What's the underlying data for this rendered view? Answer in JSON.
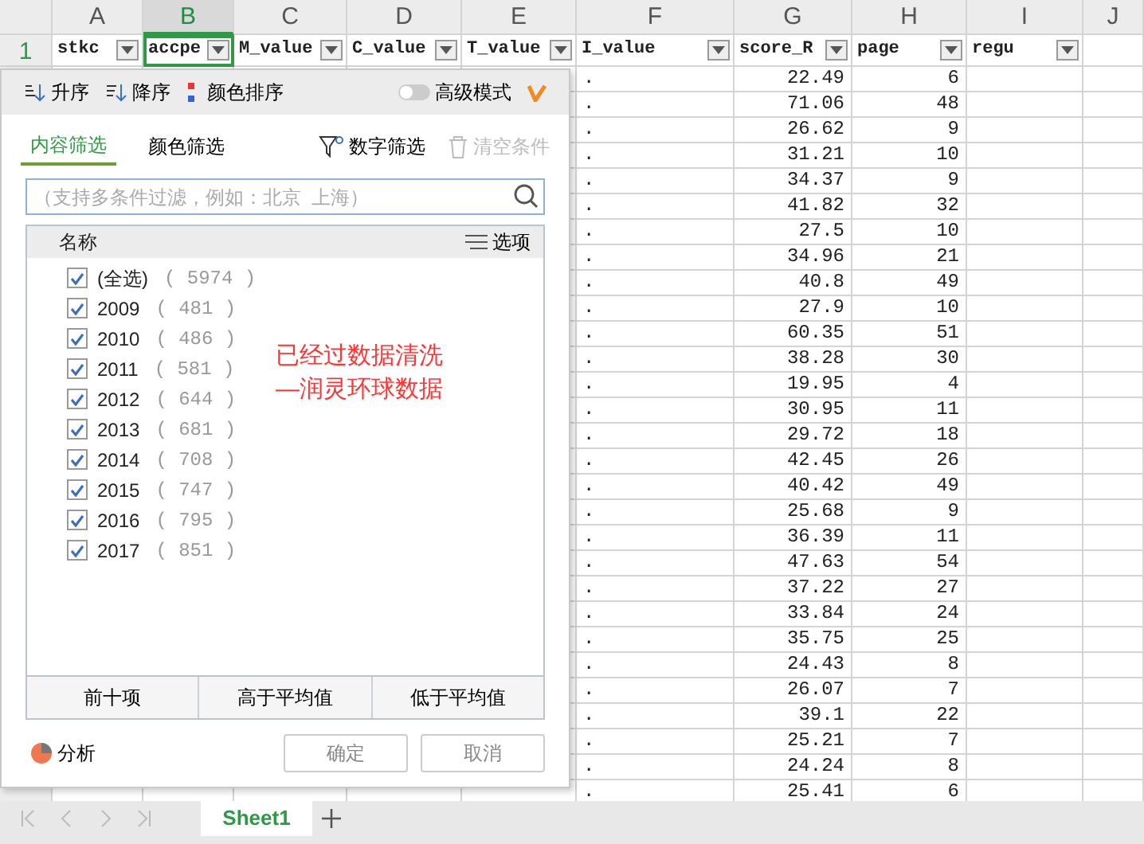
{
  "column_headers": [
    {
      "label": "A",
      "selected": false
    },
    {
      "label": "B",
      "selected": true
    },
    {
      "label": "C",
      "selected": false
    },
    {
      "label": "D",
      "selected": false
    },
    {
      "label": "E",
      "selected": false
    },
    {
      "label": "F",
      "selected": false
    },
    {
      "label": "G",
      "selected": false
    },
    {
      "label": "H",
      "selected": false
    },
    {
      "label": "I",
      "selected": false
    },
    {
      "label": "J",
      "selected": false
    }
  ],
  "header_row": {
    "row_number": "1",
    "cells": [
      {
        "text": "stkc",
        "selected": false
      },
      {
        "text": "accpe",
        "selected": true
      },
      {
        "text": "M_value",
        "selected": false
      },
      {
        "text": "C_value",
        "selected": false
      },
      {
        "text": "T_value",
        "selected": false
      },
      {
        "text": "I_value",
        "selected": false
      },
      {
        "text": "score_R",
        "selected": false
      },
      {
        "text": "page",
        "selected": false
      },
      {
        "text": "regu",
        "selected": false
      }
    ]
  },
  "rows": [
    {
      "i_value": ".",
      "score_r": "22.49",
      "page": "6"
    },
    {
      "i_value": ".",
      "score_r": "71.06",
      "page": "48"
    },
    {
      "i_value": ".",
      "score_r": "26.62",
      "page": "9"
    },
    {
      "i_value": ".",
      "score_r": "31.21",
      "page": "10"
    },
    {
      "i_value": ".",
      "score_r": "34.37",
      "page": "9"
    },
    {
      "i_value": ".",
      "score_r": "41.82",
      "page": "32"
    },
    {
      "i_value": ".",
      "score_r": "27.5",
      "page": "10"
    },
    {
      "i_value": ".",
      "score_r": "34.96",
      "page": "21"
    },
    {
      "i_value": ".",
      "score_r": "40.8",
      "page": "49"
    },
    {
      "i_value": ".",
      "score_r": "27.9",
      "page": "10"
    },
    {
      "i_value": ".",
      "score_r": "60.35",
      "page": "51"
    },
    {
      "i_value": ".",
      "score_r": "38.28",
      "page": "30"
    },
    {
      "i_value": ".",
      "score_r": "19.95",
      "page": "4"
    },
    {
      "i_value": ".",
      "score_r": "30.95",
      "page": "11"
    },
    {
      "i_value": ".",
      "score_r": "29.72",
      "page": "18"
    },
    {
      "i_value": ".",
      "score_r": "42.45",
      "page": "26"
    },
    {
      "i_value": ".",
      "score_r": "40.42",
      "page": "49"
    },
    {
      "i_value": ".",
      "score_r": "25.68",
      "page": "9"
    },
    {
      "i_value": ".",
      "score_r": "36.39",
      "page": "11"
    },
    {
      "i_value": ".",
      "score_r": "47.63",
      "page": "54"
    },
    {
      "i_value": ".",
      "score_r": "37.22",
      "page": "27"
    },
    {
      "i_value": ".",
      "score_r": "33.84",
      "page": "24"
    },
    {
      "i_value": ".",
      "score_r": "35.75",
      "page": "25"
    },
    {
      "i_value": ".",
      "score_r": "24.43",
      "page": "8"
    },
    {
      "i_value": ".",
      "score_r": "26.07",
      "page": "7"
    },
    {
      "i_value": ".",
      "score_r": "39.1",
      "page": "22"
    },
    {
      "i_value": ".",
      "score_r": "25.21",
      "page": "7"
    },
    {
      "i_value": ".",
      "score_r": "24.24",
      "page": "8"
    },
    {
      "i_value": ".",
      "score_r": "25.41",
      "page": "6"
    }
  ],
  "filter_panel": {
    "sort_buttons": [
      "升序",
      "降序",
      "颜色排序"
    ],
    "advanced_mode": {
      "label": "高级模式",
      "on": false
    },
    "tabs": [
      {
        "label": "内容筛选",
        "selected": true
      },
      {
        "label": "颜色筛选",
        "selected": false
      }
    ],
    "actions": [
      {
        "label": "数字筛选",
        "disabled": false
      },
      {
        "label": "清空条件",
        "disabled": true
      }
    ],
    "search": {
      "placeholder": "（支持多条件过滤，例如：北京  上海）"
    },
    "list_header": {
      "name": "名称",
      "options": "选项"
    },
    "items": [
      {
        "label": "(全选)",
        "count": "( 5974 )",
        "checked": true
      },
      {
        "label": "2009",
        "count": "( 481 )",
        "checked": true
      },
      {
        "label": "2010",
        "count": "( 486 )",
        "checked": true
      },
      {
        "label": "2011",
        "count": "( 581 )",
        "checked": true
      },
      {
        "label": "2012",
        "count": "( 644 )",
        "checked": true
      },
      {
        "label": "2013",
        "count": "( 681 )",
        "checked": true
      },
      {
        "label": "2014",
        "count": "( 708 )",
        "checked": true
      },
      {
        "label": "2015",
        "count": "( 747 )",
        "checked": true
      },
      {
        "label": "2016",
        "count": "( 795 )",
        "checked": true
      },
      {
        "label": "2017",
        "count": "( 851 )",
        "checked": true
      }
    ],
    "annotation": [
      "已经过数据清洗",
      "—润灵环球数据"
    ],
    "quick_filters": [
      "前十项",
      "高于平均值",
      "低于平均值"
    ],
    "analysis": "分析",
    "ok": "确定",
    "cancel": "取消"
  },
  "sheet_tabs": [
    {
      "label": "Sheet1",
      "selected": true
    }
  ]
}
